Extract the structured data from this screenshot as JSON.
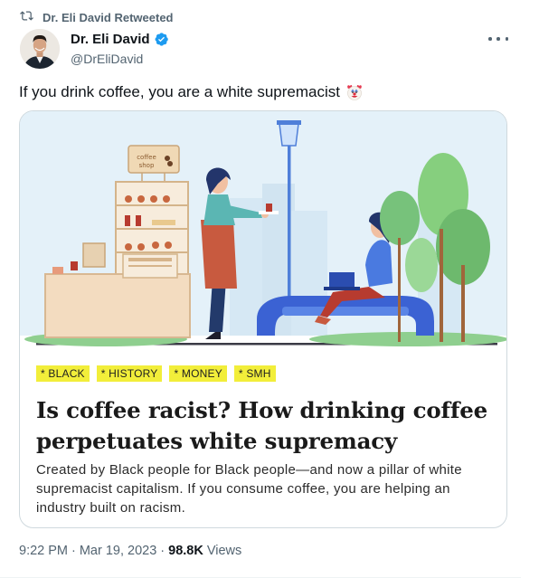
{
  "retweet": {
    "label": "Dr. Eli David Retweeted",
    "icon": "retweet-icon"
  },
  "author": {
    "name": "Dr. Eli David",
    "handle": "@DrEliDavid",
    "verified_color": "#1d9bf0"
  },
  "tweet": {
    "text": "If you drink coffee, you are a white supremacist",
    "emoji": "clown-face-icon"
  },
  "card": {
    "image": {
      "sign_line1": "coffee",
      "sign_line2": "shop"
    },
    "tags": [
      "BLACK",
      "HISTORY",
      "MONEY",
      "SMH"
    ],
    "tag_color": "#f2ee3a",
    "headline": "Is coffee racist? How drinking coffee perpetuates white supremacy",
    "subtitle": "Created by Black people for Black people—and now a pillar of white supremacist capitalism. If you consume coffee, you are helping an industry built on racism."
  },
  "meta": {
    "time": "9:22 PM",
    "separator": "·",
    "date": "Mar 19, 2023",
    "views_count": "98.8K",
    "views_label": "Views"
  },
  "colors": {
    "muted": "#536471",
    "text": "#0f1419",
    "border": "#cfd9de"
  }
}
